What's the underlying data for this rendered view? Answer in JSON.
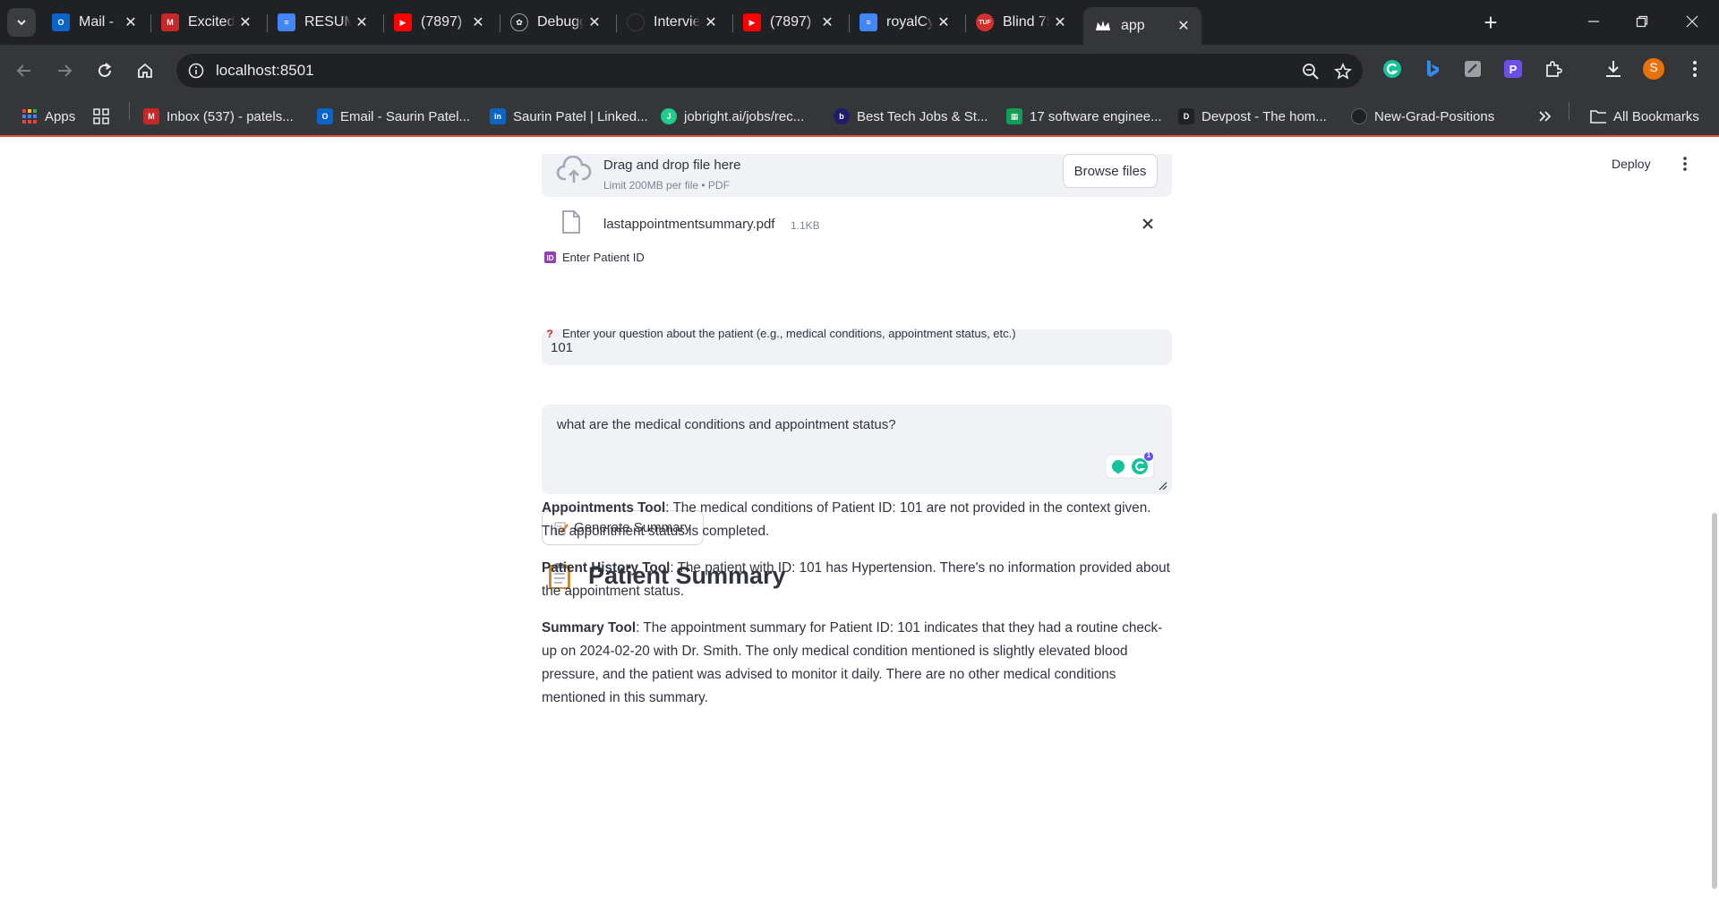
{
  "browser": {
    "tabs": [
      {
        "title": "Mail - Saurin",
        "icon": "outlook-icon",
        "color": "#0a64c8"
      },
      {
        "title": "Excited to",
        "icon": "gmail-100-icon",
        "color": "#c62828"
      },
      {
        "title": "RESUME - ",
        "icon": "google-docs-icon",
        "color": "#4285f4"
      },
      {
        "title": "(7897) Rant",
        "icon": "youtube-icon",
        "color": "#ff0000"
      },
      {
        "title": "Debugging",
        "icon": "openai-icon",
        "color": "#202124"
      },
      {
        "title": "Interview-R",
        "icon": "github-icon",
        "color": "#202124"
      },
      {
        "title": "(7897) How",
        "icon": "youtube-icon",
        "color": "#ff0000"
      },
      {
        "title": "royalCyber",
        "icon": "google-docs-icon",
        "color": "#4285f4"
      },
      {
        "title": "Blind 75 Le",
        "icon": "tuf-icon",
        "color": "#d32f2f"
      },
      {
        "title": "app",
        "icon": "streamlit-crown-icon",
        "color": "#ffffff"
      }
    ],
    "url": "localhost:8501",
    "profile_initial": "S",
    "profile_color": "#e8710a",
    "bookmarks": [
      {
        "label": "Apps",
        "icon": "apps-grid-icon"
      },
      {
        "label": "Inbox (537) - patels...",
        "icon": "gmail-100-icon"
      },
      {
        "label": "Email - Saurin Patel...",
        "icon": "outlook-icon"
      },
      {
        "label": "Saurin Patel | Linked...",
        "icon": "linkedin-icon"
      },
      {
        "label": "jobright.ai/jobs/rec...",
        "icon": "jobright-icon"
      },
      {
        "label": "Best Tech Jobs & St...",
        "icon": "builtin-icon"
      },
      {
        "label": "17 software enginee...",
        "icon": "sheet-icon"
      },
      {
        "label": "Devpost - The hom...",
        "icon": "devpost-icon"
      },
      {
        "label": "New-Grad-Positions",
        "icon": "github-icon"
      }
    ],
    "all_bookmarks_label": "All Bookmarks"
  },
  "app": {
    "deploy_label": "Deploy",
    "uploader": {
      "title": "Drag and drop file here",
      "limit": "Limit 200MB per file • PDF",
      "browse_label": "Browse files",
      "file_name": "lastappointmentsummary.pdf",
      "file_size": "1.1KB"
    },
    "patient_id": {
      "label": "Enter Patient ID",
      "icon": "id-badge-icon",
      "value": "101"
    },
    "question": {
      "label": "Enter your question about the patient (e.g., medical conditions, appointment status, etc.)",
      "icon": "red-question-mark-icon",
      "value": "what are the medical conditions and appointment status?",
      "grammarly_badge": "1"
    },
    "generate_label": "Generate Summary",
    "summary": {
      "heading": "Patient Summary",
      "items": [
        {
          "tool": "Appointments Tool",
          "text": ": The medical conditions of Patient ID: 101 are not provided in the context given. The appointment status is completed."
        },
        {
          "tool": "Patient History Tool",
          "text": ": The patient with ID: 101 has Hypertension. There's no information provided about the appointment status."
        },
        {
          "tool": "Summary Tool",
          "text": ": The appointment summary for Patient ID: 101 indicates that they had a routine check-up on 2024-02-20 with Dr. Smith. The only medical condition mentioned is slightly elevated blood pressure, and the patient was advised to monitor it daily. There are no other medical conditions mentioned in this summary."
        }
      ]
    }
  }
}
